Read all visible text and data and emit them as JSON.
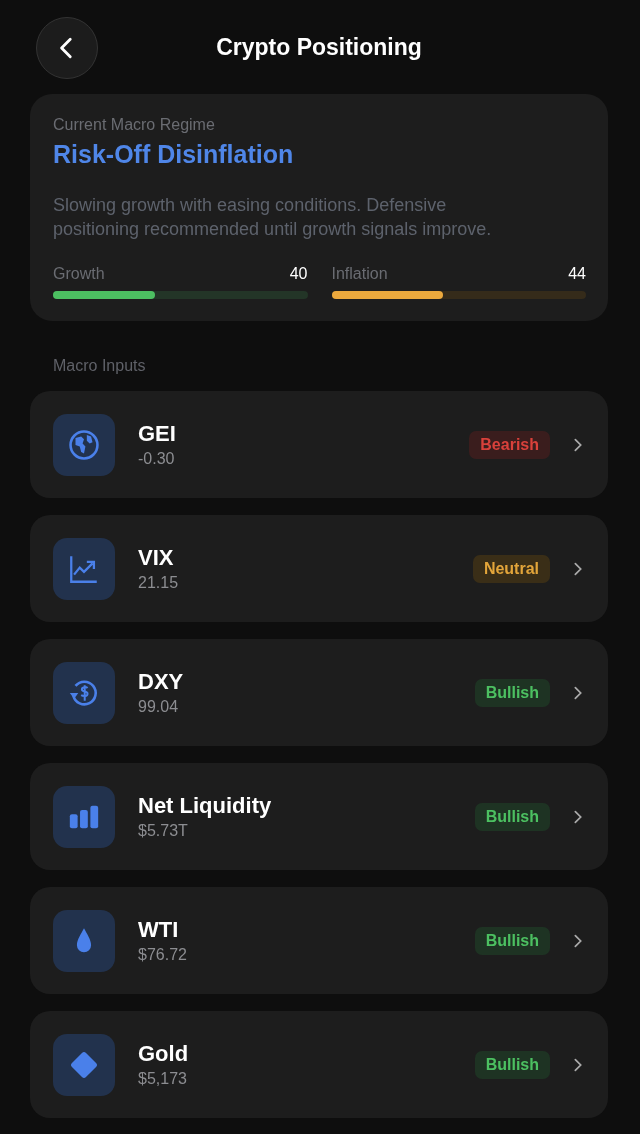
{
  "header": {
    "title": "Crypto Positioning"
  },
  "regime": {
    "label": "Current Macro Regime",
    "name": "Risk-Off Disinflation",
    "description": "Slowing growth with easing conditions. Defensive positioning recommended until growth signals improve.",
    "meters": [
      {
        "kind": "growth",
        "label": "Growth",
        "reading": "40",
        "level": 0.4
      },
      {
        "kind": "inflation",
        "label": "Inflation",
        "reading": "44",
        "level": 0.44
      }
    ]
  },
  "section_title": "Macro Inputs",
  "inputs": [
    {
      "kind": "globe",
      "name": "GEI",
      "value": "-0.30",
      "badge": {
        "text": "Bearish",
        "kind": "bearish"
      }
    },
    {
      "kind": "chart",
      "name": "VIX",
      "value": "21.15",
      "badge": {
        "text": "Neutral",
        "kind": "neutral"
      }
    },
    {
      "kind": "currency",
      "name": "DXY",
      "value": "99.04",
      "badge": {
        "text": "Bullish",
        "kind": "bullish"
      }
    },
    {
      "kind": "bars",
      "name": "Net Liquidity",
      "value": "$5.73T",
      "badge": {
        "text": "Bullish",
        "kind": "bullish"
      }
    },
    {
      "kind": "drop",
      "name": "WTI",
      "value": "$76.72",
      "badge": {
        "text": "Bullish",
        "kind": "bullish"
      }
    },
    {
      "kind": "diamond",
      "name": "Gold",
      "value": "$5,173",
      "badge": {
        "text": "Bullish",
        "kind": "bullish"
      }
    }
  ]
}
